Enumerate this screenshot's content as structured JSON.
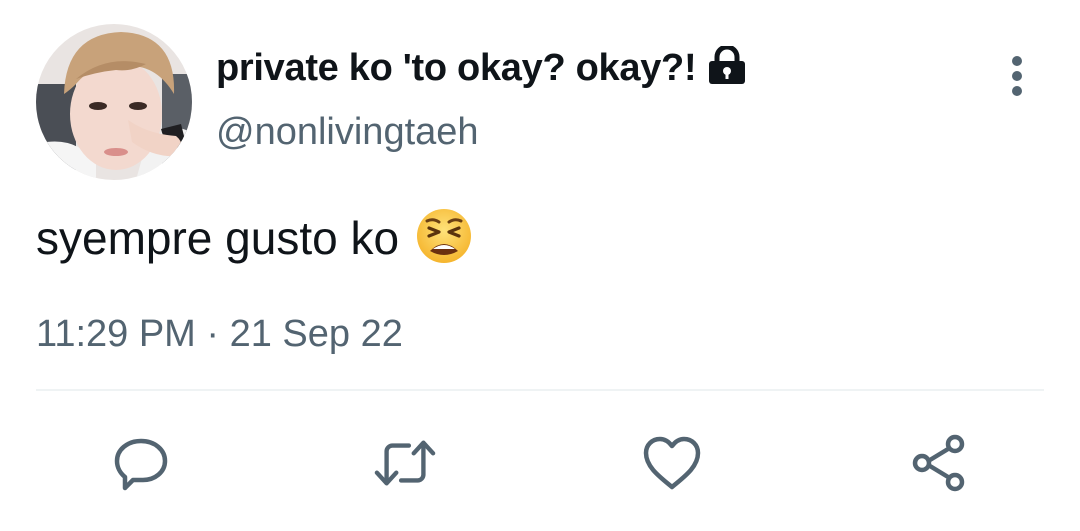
{
  "tweet": {
    "display_name": "private ko 'to okay? okay?!",
    "handle": "@nonlivingtaeh",
    "text": "syempre gusto ko",
    "emoji": "tired-face-emoji",
    "timestamp": "11:29 PM · 21 Sep 22",
    "is_protected": true
  },
  "icons": {
    "lock": "lock-icon",
    "more": "more-vertical-icon",
    "reply": "reply-icon",
    "retweet": "retweet-icon",
    "like": "heart-icon",
    "share": "share-icon"
  },
  "colors": {
    "text_primary": "#0f1419",
    "text_secondary": "#536471",
    "icon": "#536471",
    "divider": "#eff3f4",
    "background": "#ffffff"
  }
}
